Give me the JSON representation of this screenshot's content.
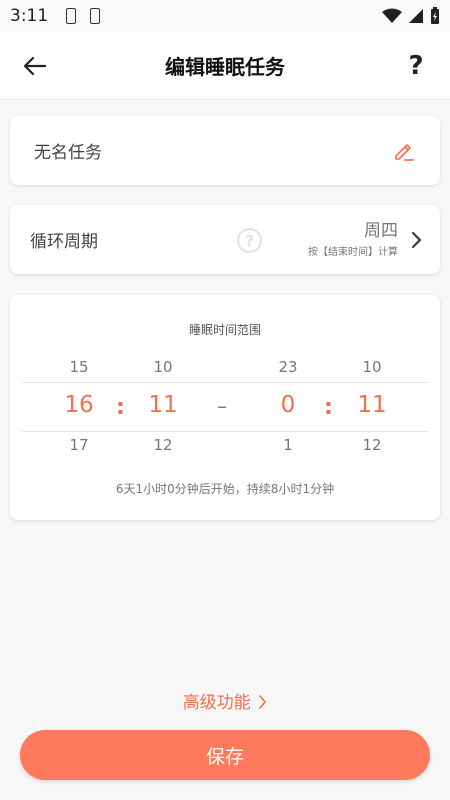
{
  "status_bar": {
    "time": "3:11"
  },
  "header": {
    "title": "编辑睡眠任务",
    "help_label": "?"
  },
  "task_name": {
    "value": "无名任务"
  },
  "cycle": {
    "label": "循环周期",
    "help_label": "?",
    "day": "周四",
    "note": "按【结束时间】计算"
  },
  "time_range": {
    "title": "睡眠时间范围",
    "start": {
      "hour": {
        "prev": "15",
        "selected": "16",
        "next": "17"
      },
      "minute": {
        "prev": "10",
        "selected": "11",
        "next": "12"
      }
    },
    "end": {
      "hour": {
        "prev": "23",
        "selected": "0",
        "next": "1"
      },
      "minute": {
        "prev": "10",
        "selected": "11",
        "next": "12"
      }
    },
    "separator": ":",
    "range_dash": "–",
    "info": "6天1小时0分钟后开始，持续8小时1分钟"
  },
  "advanced": {
    "label": "高级功能"
  },
  "save": {
    "label": "保存"
  },
  "colors": {
    "accent": "#f26f50",
    "button": "#ff7a5c"
  }
}
